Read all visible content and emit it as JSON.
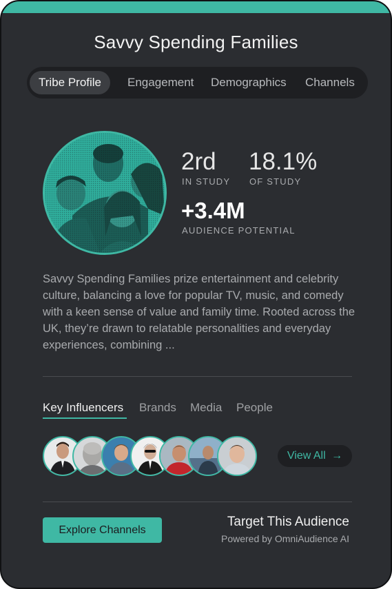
{
  "colors": {
    "accent": "#3fb8a4",
    "card_bg": "#2b2d31",
    "pill_bg": "#1e1f22"
  },
  "header": {
    "title": "Savvy Spending Families"
  },
  "tabs": [
    {
      "label": "Tribe Profile",
      "active": true
    },
    {
      "label": "Engagement",
      "active": false
    },
    {
      "label": "Demographics",
      "active": false
    },
    {
      "label": "Channels",
      "active": false
    }
  ],
  "profile_image": {
    "icon": "family-photo"
  },
  "stats": {
    "rank": {
      "value": "2rd",
      "label": "IN STUDY"
    },
    "share": {
      "value": "18.1%",
      "label": "OF STUDY"
    },
    "audience": {
      "value": "+3.4M",
      "label": "AUDIENCE POTENTIAL"
    }
  },
  "description": "Savvy Spending Families prize entertainment and celebrity culture, balancing a love for popular TV, music, and comedy with a keen sense of value and family time. Rooted across the UK, they’re drawn to relatable personalities and everyday experiences, combining ...",
  "sub_tabs": [
    {
      "label": "Key Influencers",
      "active": true
    },
    {
      "label": "Brands",
      "active": false
    },
    {
      "label": "Media",
      "active": false
    },
    {
      "label": "People",
      "active": false
    }
  ],
  "influencers": [
    {
      "icon": "influencer-avatar-1"
    },
    {
      "icon": "influencer-avatar-2"
    },
    {
      "icon": "influencer-avatar-3"
    },
    {
      "icon": "influencer-avatar-4"
    },
    {
      "icon": "influencer-avatar-5"
    },
    {
      "icon": "influencer-avatar-6"
    },
    {
      "icon": "influencer-avatar-7"
    }
  ],
  "view_all": {
    "label": "View All",
    "icon": "arrow-right-icon"
  },
  "footer": {
    "button_label": "Explore Channels",
    "target_title": "Target This Audience",
    "powered_by": "Powered by OmniAudience AI"
  }
}
